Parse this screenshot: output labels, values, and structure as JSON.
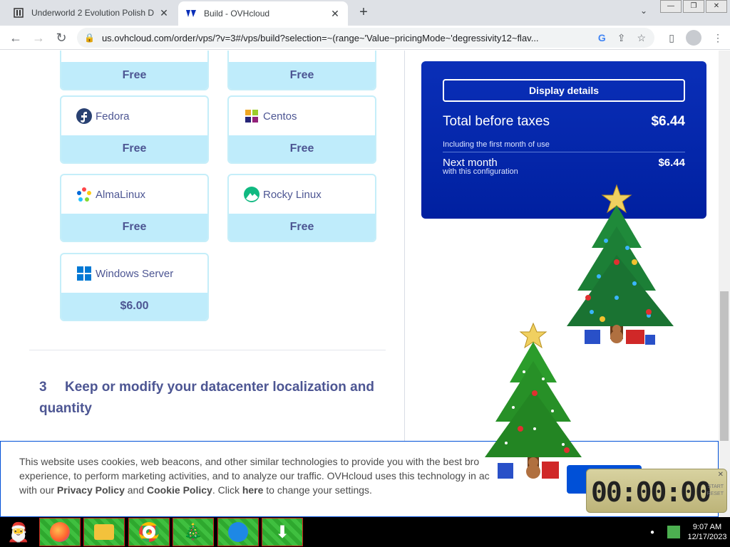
{
  "browser": {
    "tabs": [
      {
        "title": "Underworld 2 Evolution Polish D",
        "active": false
      },
      {
        "title": "Build - OVHcloud",
        "active": true
      }
    ],
    "url": "us.ovhcloud.com/order/vps/?v=3#/vps/build?selection=~(range~'Value~pricingMode~'degressivity12~flav..."
  },
  "os_options": [
    {
      "name": "",
      "price": "Free"
    },
    {
      "name": "",
      "price": "Free"
    },
    {
      "name": "Fedora",
      "price": "Free"
    },
    {
      "name": "Centos",
      "price": "Free"
    },
    {
      "name": "AlmaLinux",
      "price": "Free"
    },
    {
      "name": "Rocky Linux",
      "price": "Free"
    },
    {
      "name": "Windows Server",
      "price": "$6.00"
    }
  ],
  "step3": {
    "number": "3",
    "title": "Keep or modify your datacenter localization and quantity"
  },
  "summary": {
    "details_button": "Display details",
    "total_label": "Total before taxes",
    "total_value": "$6.44",
    "first_month_note": "Including the first month of use",
    "next_month_label": "Next month",
    "next_month_value": "$6.44",
    "next_month_sub": "with this configuration"
  },
  "cookie": {
    "line1": "This website uses cookies, web beacons, and other similar technologies to provide you with the best bro",
    "line2": "experience, to perform marketing activities, and to analyze our traffic. OVHcloud uses this technology in ac",
    "pre_privacy": "with our ",
    "privacy_link": "Privacy Policy",
    "and": " and ",
    "cookie_link": "Cookie Policy",
    "pre_here": ". Click ",
    "here_link": "here",
    "post": " to change your settings."
  },
  "clock_widget": {
    "digits": "00:00:00",
    "start": "START",
    "reset": "RESET"
  },
  "taskbar": {
    "time": "9:07 AM",
    "date": "12/17/2023"
  }
}
